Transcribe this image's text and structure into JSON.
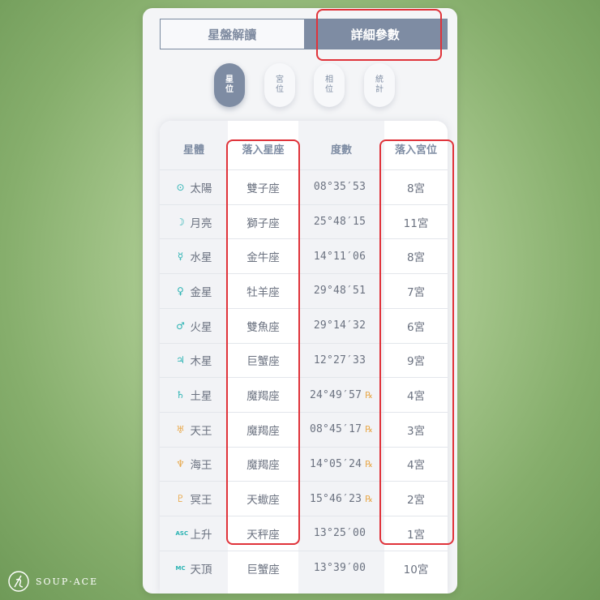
{
  "tabs": [
    {
      "label": "星盤解讀",
      "active": false
    },
    {
      "label": "詳細參數",
      "active": true
    }
  ],
  "subtabs": [
    {
      "line1": "星",
      "line2": "位",
      "active": true
    },
    {
      "line1": "宮",
      "line2": "位",
      "active": false
    },
    {
      "line1": "相",
      "line2": "位",
      "active": false
    },
    {
      "line1": "統",
      "line2": "計",
      "active": false
    }
  ],
  "table": {
    "headers": [
      "星體",
      "落入星座",
      "度數",
      "落入宮位"
    ],
    "rows": [
      {
        "symbol": "⊙",
        "color": "#2bb3b3",
        "planet": "太陽",
        "sign": "雙子座",
        "degree": "08°35′53",
        "retro": "",
        "house": "8宮"
      },
      {
        "symbol": "☽",
        "color": "#2bb3b3",
        "planet": "月亮",
        "sign": "獅子座",
        "degree": "25°48′15",
        "retro": "",
        "house": "11宮"
      },
      {
        "symbol": "☿",
        "color": "#2bb3b3",
        "planet": "水星",
        "sign": "金牛座",
        "degree": "14°11′06",
        "retro": "",
        "house": "8宮"
      },
      {
        "symbol": "♀",
        "color": "#2bb3b3",
        "planet": "金星",
        "sign": "牡羊座",
        "degree": "29°48′51",
        "retro": "",
        "house": "7宮"
      },
      {
        "symbol": "♂",
        "color": "#2bb3b3",
        "planet": "火星",
        "sign": "雙魚座",
        "degree": "29°14′32",
        "retro": "",
        "house": "6宮"
      },
      {
        "symbol": "♃",
        "color": "#2bb3b3",
        "planet": "木星",
        "sign": "巨蟹座",
        "degree": "12°27′33",
        "retro": "",
        "house": "9宮"
      },
      {
        "symbol": "♄",
        "color": "#2bb3b3",
        "planet": "土星",
        "sign": "魔羯座",
        "degree": "24°49′57",
        "retro": "℞",
        "house": "4宮"
      },
      {
        "symbol": "♅",
        "color": "#e8a94d",
        "planet": "天王",
        "sign": "魔羯座",
        "degree": "08°45′17",
        "retro": "℞",
        "house": "3宮"
      },
      {
        "symbol": "♆",
        "color": "#e8a94d",
        "planet": "海王",
        "sign": "魔羯座",
        "degree": "14°05′24",
        "retro": "℞",
        "house": "4宮"
      },
      {
        "symbol": "♇",
        "color": "#e8a94d",
        "planet": "冥王",
        "sign": "天蠍座",
        "degree": "15°46′23",
        "retro": "℞",
        "house": "2宮"
      },
      {
        "symbol": "ASC",
        "color": "#2bb3b3",
        "planet": "上升",
        "sign": "天秤座",
        "degree": "13°25′00",
        "retro": "",
        "house": "1宮"
      },
      {
        "symbol": "MC",
        "color": "#2bb3b3",
        "planet": "天頂",
        "sign": "巨蟹座",
        "degree": "13°39′00",
        "retro": "",
        "house": "10宮"
      }
    ]
  },
  "highlight_color": "#e0333a",
  "watermark": "SOUP·ACE"
}
